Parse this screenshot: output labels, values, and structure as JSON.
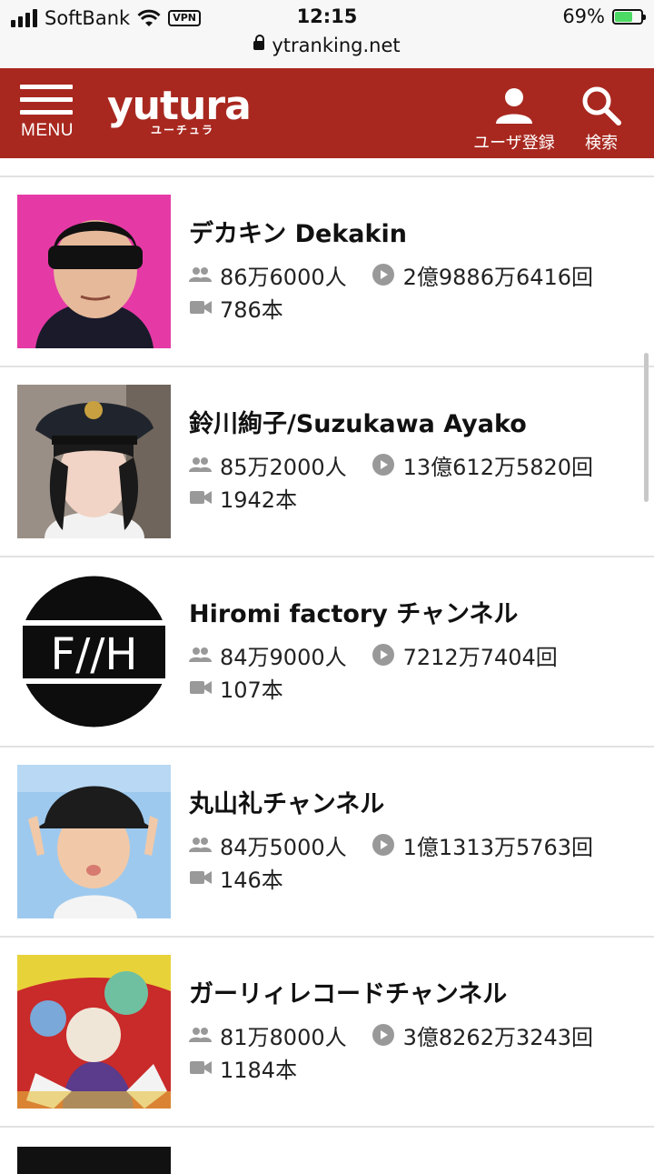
{
  "status_bar": {
    "carrier": "SoftBank",
    "vpn": "VPN",
    "time": "12:15",
    "battery": "69%",
    "battery_level": 0.69,
    "url": "ytranking.net"
  },
  "header": {
    "menu_label": "MENU",
    "logo_text": "yutura",
    "logo_sub": "ユーチュラ",
    "user_label": "ユーザ登録",
    "search_label": "検索"
  },
  "channels": [
    {
      "name": "デカキン Dekakin",
      "subscribers": "86万6000人",
      "views": "2億9886万6416回",
      "videos": "786本"
    },
    {
      "name": "鈴川絢子/Suzukawa Ayako",
      "subscribers": "85万2000人",
      "views": "13億612万5820回",
      "videos": "1942本"
    },
    {
      "name": "Hiromi factory チャンネル",
      "subscribers": "84万9000人",
      "views": "7212万7404回",
      "videos": "107本",
      "thumb_text": "F//H"
    },
    {
      "name": "丸山礼チャンネル",
      "subscribers": "84万5000人",
      "views": "1億1313万5763回",
      "videos": "146本"
    },
    {
      "name": "ガーリィレコードチャンネル",
      "subscribers": "81万8000人",
      "views": "3億8262万3243回",
      "videos": "1184本"
    }
  ]
}
